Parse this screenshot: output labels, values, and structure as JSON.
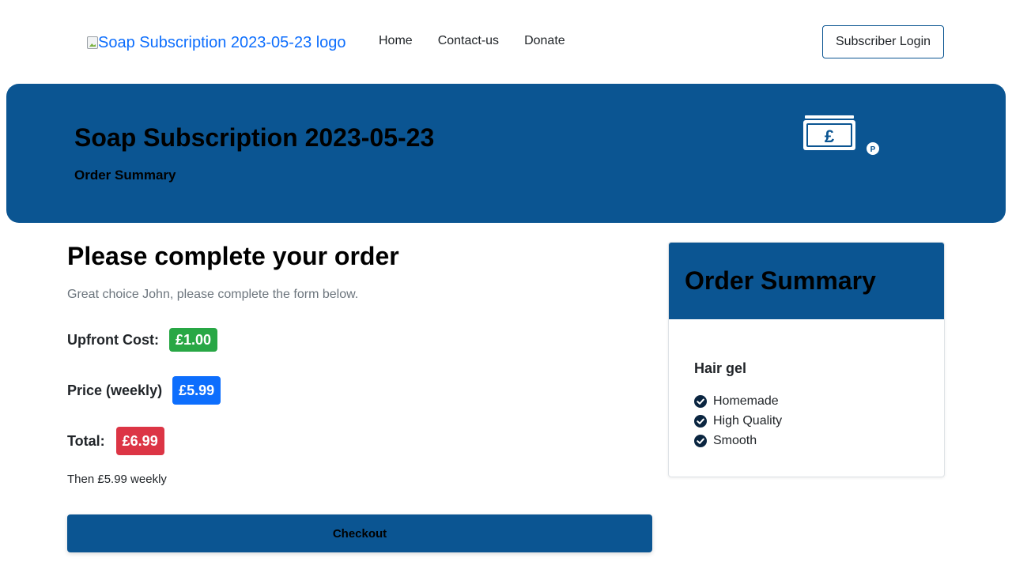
{
  "nav": {
    "logo_alt": "Soap Subscription 2023-05-23 logo",
    "links": [
      "Home",
      "Contact-us",
      "Donate"
    ],
    "login_label": "Subscriber Login"
  },
  "hero": {
    "title": "Soap Subscription 2023-05-23",
    "subtitle": "Order Summary",
    "icon": "pound-banknote-icon"
  },
  "main": {
    "heading": "Please complete your order",
    "lead": "Great choice John, please complete the form below.",
    "upfront": {
      "label": "Upfront Cost:",
      "value": "£1.00",
      "color": "#28a745"
    },
    "price": {
      "label": "Price (weekly)",
      "value": "£5.99",
      "color": "#0d6efd"
    },
    "total": {
      "label": "Total:",
      "value": "£6.99",
      "color": "#dc3545"
    },
    "then_text": "Then £5.99 weekly",
    "checkout_label": "Checkout"
  },
  "summary": {
    "title": "Order Summary",
    "product": "Hair gel",
    "features": [
      "Homemade",
      "High Quality",
      "Smooth"
    ]
  },
  "colors": {
    "brand": "#0b5592",
    "link": "#0d6efd"
  }
}
